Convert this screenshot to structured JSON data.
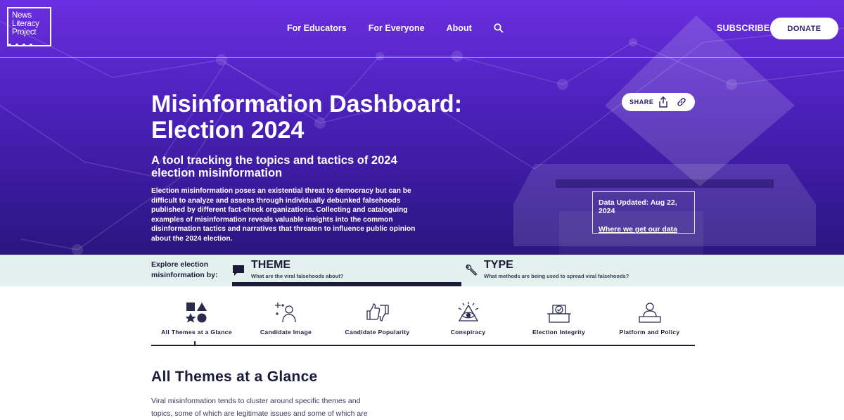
{
  "brand": {
    "logo_lines": [
      "News",
      "Literacy",
      "Project"
    ]
  },
  "nav": {
    "links": [
      "For Educators",
      "For Everyone",
      "About"
    ],
    "search_icon": "search-icon",
    "subscribe": "SUBSCRIBE",
    "donate": "DONATE"
  },
  "hero": {
    "title_line1": "Misinformation Dashboard:",
    "title_line2": "Election 2024",
    "subtitle": "A tool tracking the topics and tactics of 2024 election misinformation",
    "intro": "Election misinformation poses an existential threat to democracy but can be difficult to analyze and assess through individually debunked falsehoods published by different fact-check organizations. Collecting and cataloguing examples of misinformation reveals valuable insights into the common disinformation tactics and narratives that threaten to influence public opinion about the 2024 election.",
    "share_label": "SHARE",
    "data_updated": "Data Updated: Aug 22, 2024",
    "data_link": "Where we get our data"
  },
  "explore": {
    "label": "Explore election misinformation by:",
    "tabs": [
      {
        "title": "THEME",
        "desc": "What are the viral falsehoods about?",
        "icon": "speech-bubble-icon",
        "selected": true
      },
      {
        "title": "TYPE",
        "desc": "What methods are being used to spread viral falsehoods?",
        "icon": "wrench-icon",
        "selected": false
      }
    ]
  },
  "themes": [
    {
      "label": "All Themes at a Glance",
      "icon": "shapes-icon",
      "selected": true
    },
    {
      "label": "Candidate Image",
      "icon": "sparkle-person-icon",
      "selected": false
    },
    {
      "label": "Candidate Popularity",
      "icon": "thumbs-icon",
      "selected": false
    },
    {
      "label": "Conspiracy",
      "icon": "eye-pyramid-icon",
      "selected": false
    },
    {
      "label": "Election Integrity",
      "icon": "ballot-box-icon",
      "selected": false
    },
    {
      "label": "Platform and Policy",
      "icon": "podium-person-icon",
      "selected": false
    }
  ],
  "content": {
    "title": "All Themes at a Glance",
    "body": "Viral misinformation tends to cluster around specific themes and topics, some of which are legitimate issues and some of which are"
  },
  "colors": {
    "hero_top": "#6a2ee0",
    "hero_bottom": "#2a1580",
    "explore_bg": "#e3f1ee",
    "ink": "#1b1b3a"
  }
}
